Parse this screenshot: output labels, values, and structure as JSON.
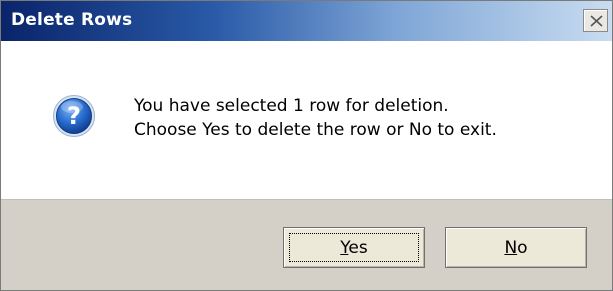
{
  "dialog": {
    "title": "Delete Rows",
    "close_icon": "close-icon",
    "icon": "question-icon",
    "message_line1": "You have selected 1 row for deletion.",
    "message_line2": "Choose Yes to delete the row or No to exit.",
    "buttons": {
      "yes": {
        "accel": "Y",
        "rest": "es"
      },
      "no": {
        "accel": "N",
        "rest": "o"
      }
    }
  },
  "colors": {
    "title_start": "#0a246a",
    "title_end": "#c9dcf1",
    "icon_blue": "#1f5fbf",
    "footer_bg": "#d4d0c8"
  }
}
